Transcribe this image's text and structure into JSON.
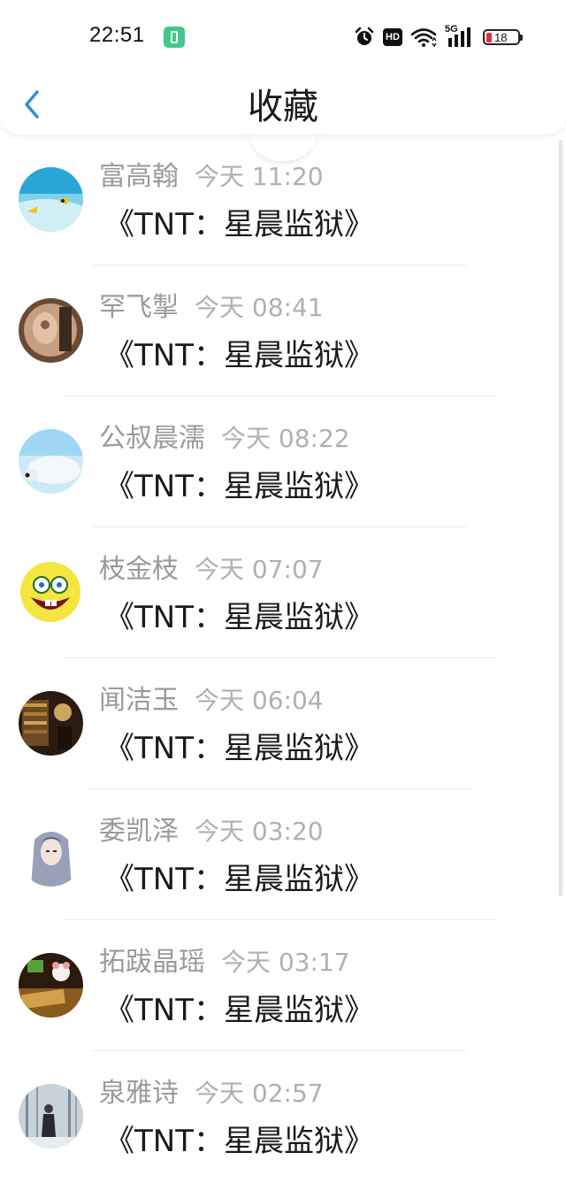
{
  "status_bar": {
    "time": "22:51",
    "hd_label": "HD",
    "network_label": "5G",
    "battery_level": "18"
  },
  "header": {
    "title": "收藏"
  },
  "favorites": [
    {
      "name": "富高翰",
      "time": "今天 11:20",
      "title": "《TNT：星晨监狱》"
    },
    {
      "name": "罕飞掣",
      "time": "今天 08:41",
      "title": "《TNT：星晨监狱》"
    },
    {
      "name": "公叔晨濡",
      "time": "今天 08:22",
      "title": "《TNT：星晨监狱》"
    },
    {
      "name": "枝金枝",
      "time": "今天 07:07",
      "title": "《TNT：星晨监狱》"
    },
    {
      "name": "闻洁玉",
      "time": "今天 06:04",
      "title": "《TNT：星晨监狱》"
    },
    {
      "name": "委凯泽",
      "time": "今天 03:20",
      "title": "《TNT：星晨监狱》"
    },
    {
      "name": "拓跋晶瑶",
      "time": "今天 03:17",
      "title": "《TNT：星晨监狱》"
    },
    {
      "name": "泉雅诗",
      "time": "今天 02:57",
      "title": "《TNT：星晨监狱》"
    }
  ],
  "colors": {
    "accent": "#2e8fd8",
    "name_text": "#9a9a9a",
    "time_text": "#b0b0b0",
    "title_text": "#1a1a1a",
    "battery_low": "#e0303a"
  }
}
